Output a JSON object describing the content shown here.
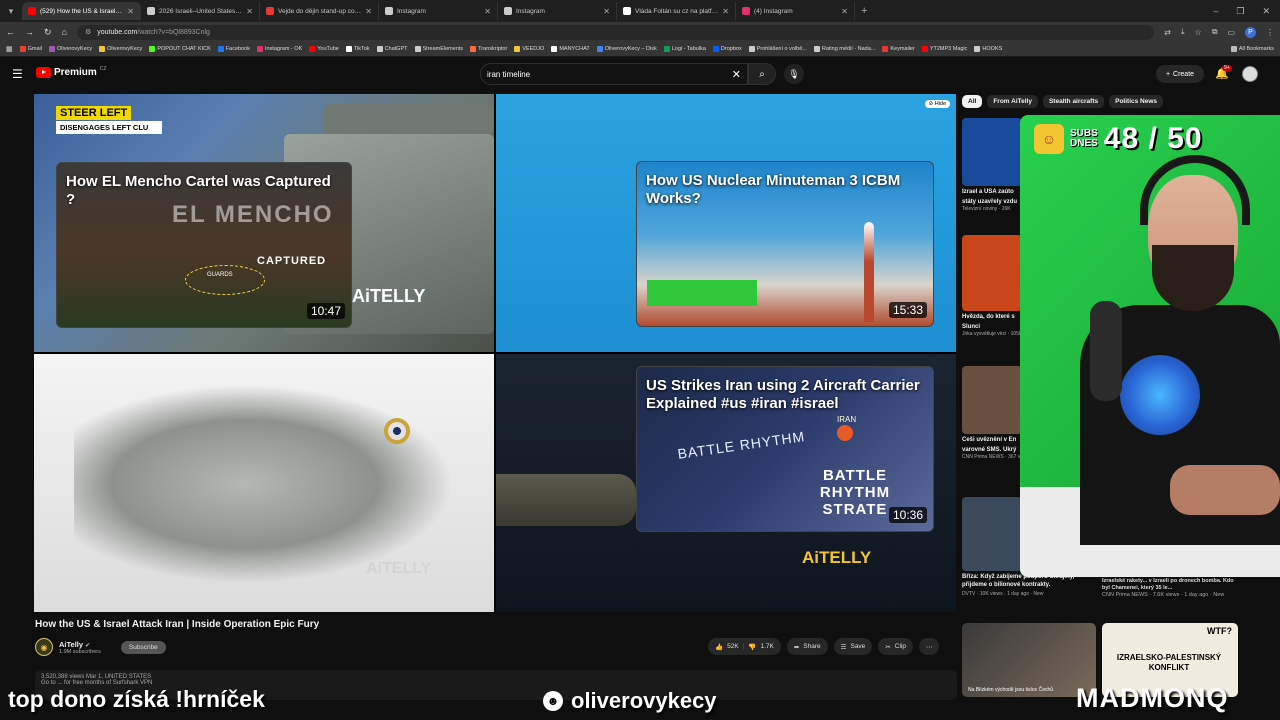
{
  "browser": {
    "tabs": [
      {
        "title": "(529) How the US & Israel Attac",
        "favicon_color": "#ff0000",
        "active": true
      },
      {
        "title": "2026 Israeli–United States strik",
        "favicon_color": "#cccccc",
        "active": false
      },
      {
        "title": "Vejde do dějin stand-up comed",
        "favicon_color": "#e53935",
        "active": false
      },
      {
        "title": "Instagram",
        "favicon_color": "#cccccc",
        "active": false
      },
      {
        "title": "Instagram",
        "favicon_color": "#cccccc",
        "active": false
      },
      {
        "title": "Vláda Foltán su cz na platform",
        "favicon_color": "#ffffff",
        "active": false
      },
      {
        "title": "(4) Instagram",
        "favicon_color": "#e1306c",
        "active": false
      }
    ],
    "url_domain": "youtube.com",
    "url_path": "/watch?v=bQl8893Cnlg",
    "bookmarks": [
      {
        "label": "Gmail",
        "color": "#ea4335"
      },
      {
        "label": "OliverovyKecy",
        "color": "#9b59b6"
      },
      {
        "label": "OliverovyKecy",
        "color": "#f2c633"
      },
      {
        "label": "POPOUT CHAT KICK",
        "color": "#53fc18"
      },
      {
        "label": "Facebook",
        "color": "#1877f2"
      },
      {
        "label": "Instagram - OK",
        "color": "#e1306c"
      },
      {
        "label": "YouTube",
        "color": "#ff0000"
      },
      {
        "label": "TikTok",
        "color": "#ffffff"
      },
      {
        "label": "ChatGPT",
        "color": "#cccccc"
      },
      {
        "label": "StreamElements",
        "color": "#cccccc"
      },
      {
        "label": "Transkriptor",
        "color": "#ff6b3d"
      },
      {
        "label": "VEEDJO",
        "color": "#f2c633"
      },
      {
        "label": "MANYCHAT",
        "color": "#ffffff"
      },
      {
        "label": "OliverovyKecy – Disk",
        "color": "#4285f4"
      },
      {
        "label": "Logi - Tabulka",
        "color": "#0f9d58"
      },
      {
        "label": "Dropbox",
        "color": "#0061ff"
      },
      {
        "label": "Prohlášení o volbě...",
        "color": "#cccccc"
      },
      {
        "label": "Rating médií - Nada...",
        "color": "#cccccc"
      },
      {
        "label": "Keymailer",
        "color": "#e53935"
      },
      {
        "label": "YT2MP3 Magic",
        "color": "#ff0000"
      },
      {
        "label": "HOOKS",
        "color": "#cccccc"
      }
    ],
    "all_bookmarks": "All Bookmarks",
    "profile_letter": "P"
  },
  "youtube": {
    "logo_text": "Premium",
    "logo_region": "CZ",
    "search_value": "iran timeline",
    "create_label": "Create",
    "notifications_badge": "9+",
    "video": {
      "title": "How the US & Israel Attack Iran | Inside Operation Epic Fury",
      "channel_name": "AiTelly",
      "channel_subs": "1.9M subscribers",
      "subscribe_label": "Subscribe",
      "likes": "52K",
      "dislikes": "1.7K",
      "share_label": "Share",
      "save_label": "Save",
      "clip_label": "Clip",
      "description_line1": "3,520,388 views  Mar 1,  UNITED STATES",
      "description_line2": "Go to ... for free months of Surfshark VPN"
    },
    "end_screen": {
      "steer_left": "STEER LEFT",
      "disengages": "DISENGAGES LEFT CLU",
      "hide_label": "Hide",
      "mencho_overlay": "EL MENCHO",
      "captured_overlay": "CAPTURED",
      "guards_label": "GUARDS",
      "brand": "AiTELLY",
      "brand_b": "AiTELLY",
      "battle_overlay_1": "BATTLE RHYTHM",
      "battle_overlay_2": "BATTLE RHYTHM STRATE",
      "iran_label": "IRAN",
      "cards": [
        {
          "title": "How EL Mencho Cartel was Captured ?",
          "duration": "10:47"
        },
        {
          "title": "How US Nuclear Minuteman 3 ICBM Works?",
          "duration": "15:33"
        },
        {
          "title": "US Strikes Iran using 2 Aircraft Carrier Explained #us #iran #israel",
          "duration": "10:36"
        }
      ]
    },
    "sidebar": {
      "chips": [
        "All",
        "From AiTelly",
        "Stealth aircrafts",
        "Politics News"
      ],
      "items": [
        {
          "title": "Izrael a USA zaúto",
          "subtitle": "státy uzavřely vzdu",
          "meta": "Televizní noviny · 26K",
          "thumb_color": "#1a4a9c"
        },
        {
          "title": "Hvězda, do které s",
          "subtitle": "Slunci",
          "meta": "Jirka vysvětluje věci · 105K views · 18 hours",
          "thumb_color": "#c8461a"
        },
        {
          "title": "Češi uvěznění v En",
          "subtitle": "varovné SMS. Ukrý",
          "meta": "CNN Prima NEWS · 367 views · 22 minutes",
          "thumb_color": "#6a5040"
        },
        {
          "title": "Bříza: Když zabijeme podporu Ukrajiny, přijdeme o bilionové kontrakty.",
          "subtitle": "",
          "meta": "DVTV · 10K views · 1 day ago · New",
          "thumb_color": "#3a4a5a"
        }
      ],
      "thumb_tags": {
        "live": "Live",
        "izrael": "Izrael a USA zaho",
        "slunce": "SLUNCE",
        "canis": "CANIS M",
        "cesi": "ČEŠI UVĚZNĚNÍ",
        "vlastislav": "Vlastislav Bří"
      },
      "second_col_title": "Izraelské rakety... v Izraeli po dronech bomba. Kdo byl Chamenei, který 35 le...",
      "second_col_meta": "CNN Prima NEWS · 7.6K views · 1 day ago · New",
      "bottom_thumb_left_caption": "Na Blízkém východě jsou tisíce Čechů",
      "bottom_thumb_right_title": "IZRAELSKO-PALESTINSKÝ KONFLIKT",
      "bottom_thumb_right_wtf": "WTF?"
    }
  },
  "stream_overlay": {
    "subs_label_1": "SUBS",
    "subs_label_2": "DNES",
    "subs_count": "48 / 50",
    "bottom_left": "top dono získá !hrníček",
    "bottom_middle": "oliverovykecy",
    "bottom_right": "MADMONQ"
  }
}
